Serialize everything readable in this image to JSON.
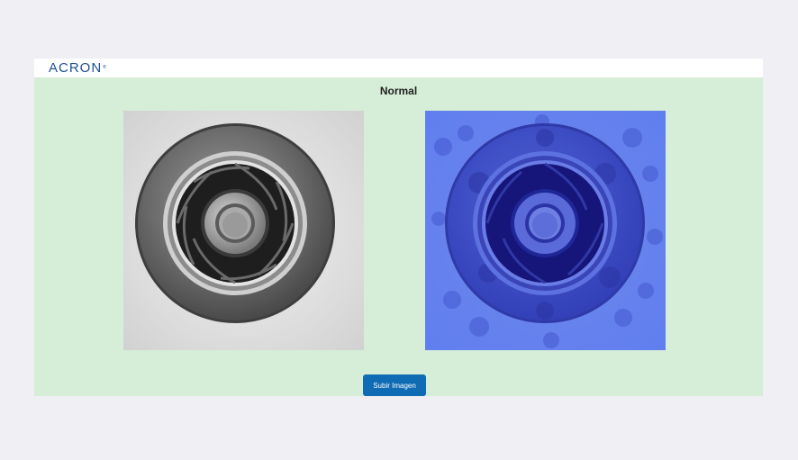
{
  "header": {
    "logo_text": "ACRON",
    "logo_mark": "®"
  },
  "result": {
    "label": "Normal"
  },
  "images": {
    "original": {
      "description": "grayscale impeller image"
    },
    "heatmap": {
      "description": "heatmap overlay"
    }
  },
  "actions": {
    "upload_label": "Subir Imagen"
  },
  "colors": {
    "page_bg": "#efeff4",
    "content_bg": "#d6edd7",
    "brand": "#1d4f91",
    "button": "#0f6bb3"
  }
}
